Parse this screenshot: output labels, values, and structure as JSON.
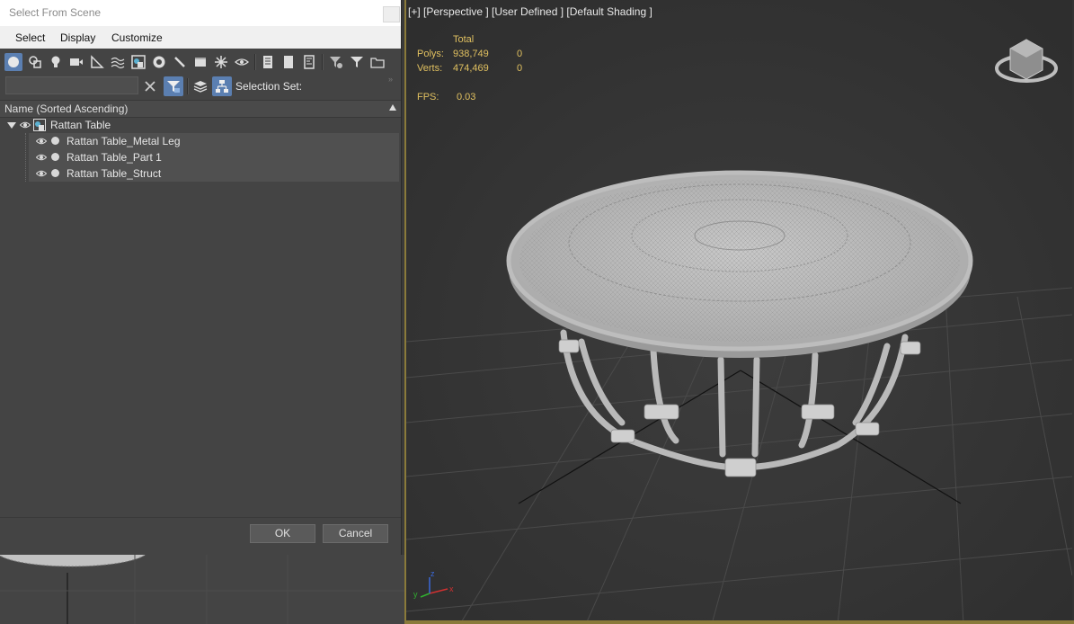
{
  "dialog": {
    "title": "Select From Scene",
    "menu": [
      "Select",
      "Display",
      "Customize"
    ],
    "filter": {
      "search_value": "",
      "selection_set_label": "Selection Set:"
    },
    "list": {
      "header": "Name (Sorted Ascending)",
      "root": {
        "label": "Rattan Table"
      },
      "children": [
        {
          "label": "Rattan Table_Metal Leg"
        },
        {
          "label": "Rattan Table_Part 1"
        },
        {
          "label": "Rattan Table_Struct"
        }
      ]
    },
    "buttons": {
      "ok": "OK",
      "cancel": "Cancel"
    }
  },
  "viewport": {
    "label": "[+] [Perspective ] [User Defined ] [Default Shading ]",
    "stats": {
      "total_label": "Total",
      "polys_label": "Polys:",
      "polys_value": "938,749",
      "polys_sel": "0",
      "verts_label": "Verts:",
      "verts_value": "474,469",
      "verts_sel": "0",
      "fps_label": "FPS:",
      "fps_value": "0.03"
    },
    "axes": {
      "x": "x",
      "y": "y",
      "z": "z"
    }
  },
  "colors": {
    "accent_blue": "#5b7fb1",
    "stats_yellow": "#e0c060",
    "viewport_border": "#8a7a3a"
  }
}
